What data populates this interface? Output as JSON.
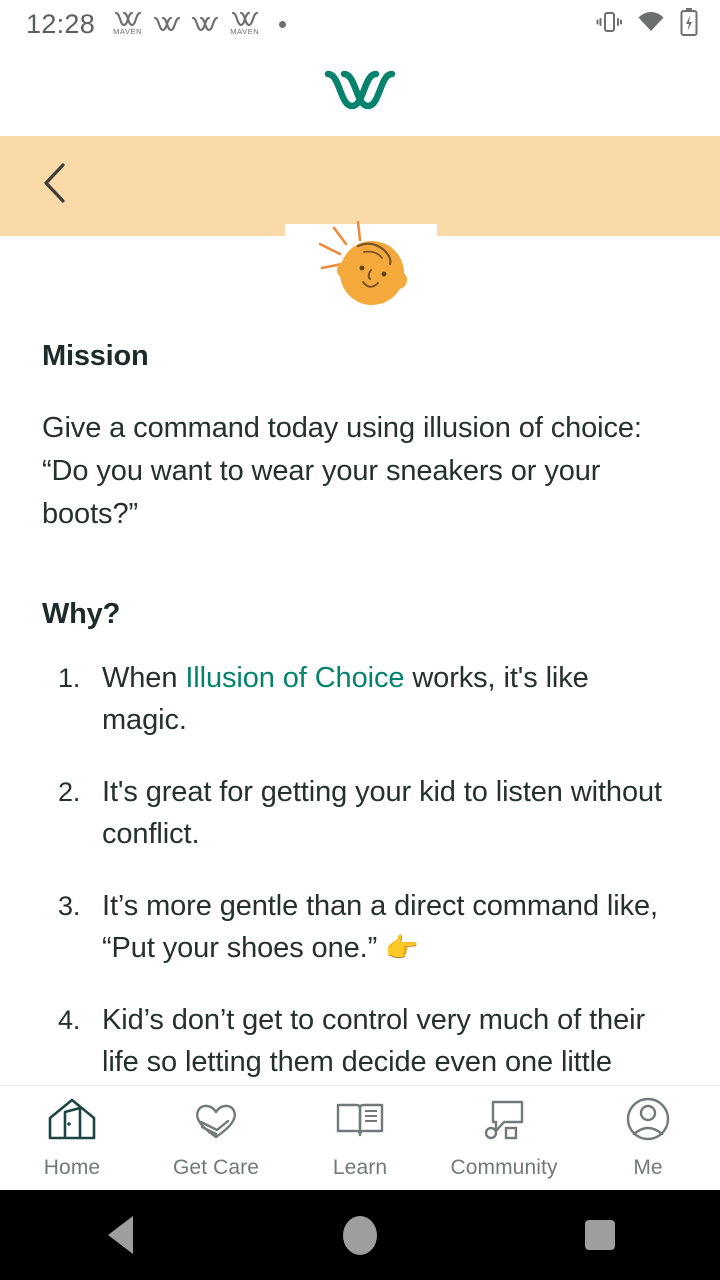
{
  "status_bar": {
    "time": "12:28",
    "notification_icons": [
      {
        "name": "maven-notification-icon",
        "label": "MAVEN"
      },
      {
        "name": "maven-notification-icon",
        "label": ""
      },
      {
        "name": "maven-notification-icon",
        "label": ""
      },
      {
        "name": "maven-notification-icon",
        "label": "MAVEN"
      }
    ],
    "more_notifications_dot": "more-notifications-dot",
    "right_icons": [
      "vibrate-icon",
      "wifi-icon",
      "battery-charging-icon"
    ]
  },
  "app_header": {
    "logo": "maven-logo",
    "brand_color": "#05836d"
  },
  "sub_header": {
    "background_color": "#fadaa8",
    "back_label": "Back"
  },
  "illustration": {
    "name": "baby-face-sun-illustration",
    "color": "#f4a93c"
  },
  "main": {
    "mission_title": "Mission",
    "mission_body": "Give a command today using illusion of choice: “Do you want to wear your sneakers or your boots?”",
    "why_title": "Why?",
    "why_items": [
      {
        "pre": "When ",
        "link": "Illusion of Choice",
        "post": " works, it's like magic.",
        "emoji": ""
      },
      {
        "pre": "It's great for getting your kid to listen without conflict.",
        "link": "",
        "post": "",
        "emoji": ""
      },
      {
        "pre": "It’s more gentle than a direct command like, “Put your shoes one.” ",
        "link": "",
        "post": "",
        "emoji": "👉"
      },
      {
        "pre": "Kid’s don’t get to control very much of their life so letting them decide even one little thing is empowering.",
        "link": "",
        "post": "",
        "emoji": ""
      }
    ],
    "link_color": "#05836d"
  },
  "bottom_nav": {
    "items": [
      {
        "label": "Home",
        "icon": "home-house-icon",
        "active": true
      },
      {
        "label": "Get Care",
        "icon": "heart-hand-icon",
        "active": false
      },
      {
        "label": "Learn",
        "icon": "open-book-icon",
        "active": false
      },
      {
        "label": "Community",
        "icon": "speech-bubble-icon",
        "active": false
      },
      {
        "label": "Me",
        "icon": "person-avatar-icon",
        "active": false
      }
    ],
    "active_color": "#1d4440",
    "inactive_color": "#72797a"
  },
  "system_nav": {
    "buttons": [
      "back-triangle-button",
      "home-circle-button",
      "recents-square-button"
    ]
  }
}
